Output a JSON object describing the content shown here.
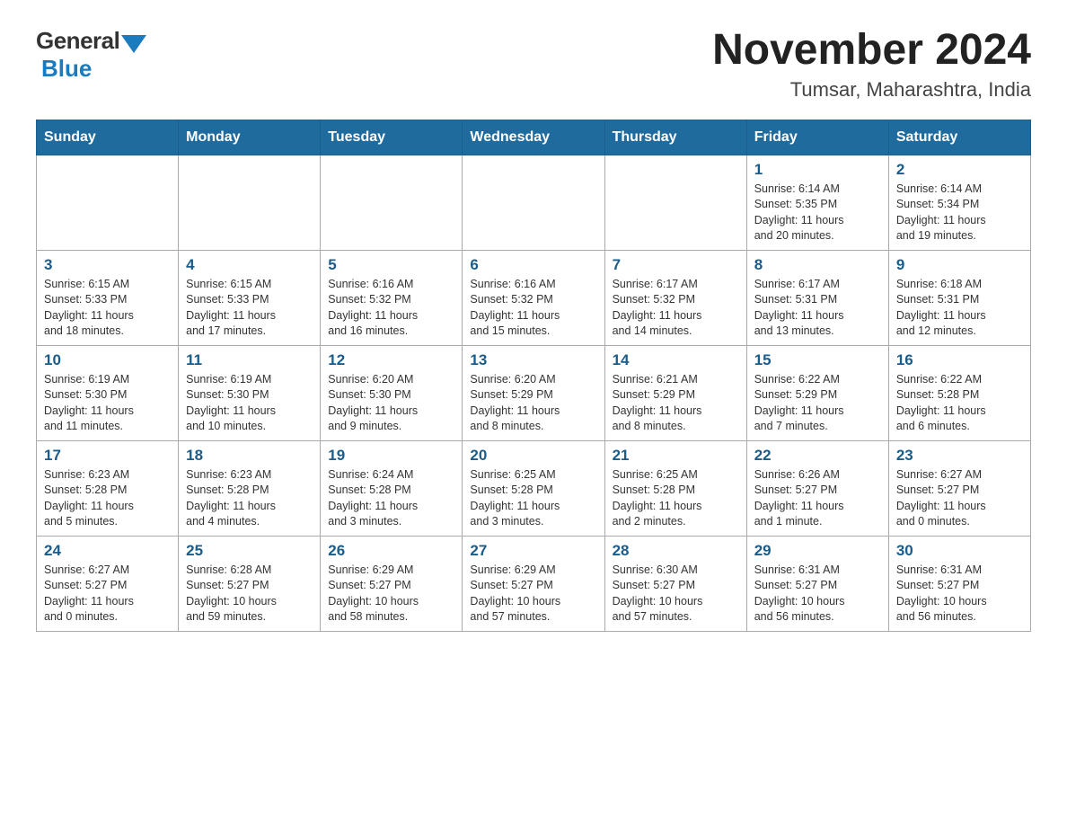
{
  "header": {
    "logo_general": "General",
    "logo_blue": "Blue",
    "month_year": "November 2024",
    "location": "Tumsar, Maharashtra, India"
  },
  "days_of_week": [
    "Sunday",
    "Monday",
    "Tuesday",
    "Wednesday",
    "Thursday",
    "Friday",
    "Saturday"
  ],
  "weeks": [
    [
      {
        "day": "",
        "info": ""
      },
      {
        "day": "",
        "info": ""
      },
      {
        "day": "",
        "info": ""
      },
      {
        "day": "",
        "info": ""
      },
      {
        "day": "",
        "info": ""
      },
      {
        "day": "1",
        "info": "Sunrise: 6:14 AM\nSunset: 5:35 PM\nDaylight: 11 hours\nand 20 minutes."
      },
      {
        "day": "2",
        "info": "Sunrise: 6:14 AM\nSunset: 5:34 PM\nDaylight: 11 hours\nand 19 minutes."
      }
    ],
    [
      {
        "day": "3",
        "info": "Sunrise: 6:15 AM\nSunset: 5:33 PM\nDaylight: 11 hours\nand 18 minutes."
      },
      {
        "day": "4",
        "info": "Sunrise: 6:15 AM\nSunset: 5:33 PM\nDaylight: 11 hours\nand 17 minutes."
      },
      {
        "day": "5",
        "info": "Sunrise: 6:16 AM\nSunset: 5:32 PM\nDaylight: 11 hours\nand 16 minutes."
      },
      {
        "day": "6",
        "info": "Sunrise: 6:16 AM\nSunset: 5:32 PM\nDaylight: 11 hours\nand 15 minutes."
      },
      {
        "day": "7",
        "info": "Sunrise: 6:17 AM\nSunset: 5:32 PM\nDaylight: 11 hours\nand 14 minutes."
      },
      {
        "day": "8",
        "info": "Sunrise: 6:17 AM\nSunset: 5:31 PM\nDaylight: 11 hours\nand 13 minutes."
      },
      {
        "day": "9",
        "info": "Sunrise: 6:18 AM\nSunset: 5:31 PM\nDaylight: 11 hours\nand 12 minutes."
      }
    ],
    [
      {
        "day": "10",
        "info": "Sunrise: 6:19 AM\nSunset: 5:30 PM\nDaylight: 11 hours\nand 11 minutes."
      },
      {
        "day": "11",
        "info": "Sunrise: 6:19 AM\nSunset: 5:30 PM\nDaylight: 11 hours\nand 10 minutes."
      },
      {
        "day": "12",
        "info": "Sunrise: 6:20 AM\nSunset: 5:30 PM\nDaylight: 11 hours\nand 9 minutes."
      },
      {
        "day": "13",
        "info": "Sunrise: 6:20 AM\nSunset: 5:29 PM\nDaylight: 11 hours\nand 8 minutes."
      },
      {
        "day": "14",
        "info": "Sunrise: 6:21 AM\nSunset: 5:29 PM\nDaylight: 11 hours\nand 8 minutes."
      },
      {
        "day": "15",
        "info": "Sunrise: 6:22 AM\nSunset: 5:29 PM\nDaylight: 11 hours\nand 7 minutes."
      },
      {
        "day": "16",
        "info": "Sunrise: 6:22 AM\nSunset: 5:28 PM\nDaylight: 11 hours\nand 6 minutes."
      }
    ],
    [
      {
        "day": "17",
        "info": "Sunrise: 6:23 AM\nSunset: 5:28 PM\nDaylight: 11 hours\nand 5 minutes."
      },
      {
        "day": "18",
        "info": "Sunrise: 6:23 AM\nSunset: 5:28 PM\nDaylight: 11 hours\nand 4 minutes."
      },
      {
        "day": "19",
        "info": "Sunrise: 6:24 AM\nSunset: 5:28 PM\nDaylight: 11 hours\nand 3 minutes."
      },
      {
        "day": "20",
        "info": "Sunrise: 6:25 AM\nSunset: 5:28 PM\nDaylight: 11 hours\nand 3 minutes."
      },
      {
        "day": "21",
        "info": "Sunrise: 6:25 AM\nSunset: 5:28 PM\nDaylight: 11 hours\nand 2 minutes."
      },
      {
        "day": "22",
        "info": "Sunrise: 6:26 AM\nSunset: 5:27 PM\nDaylight: 11 hours\nand 1 minute."
      },
      {
        "day": "23",
        "info": "Sunrise: 6:27 AM\nSunset: 5:27 PM\nDaylight: 11 hours\nand 0 minutes."
      }
    ],
    [
      {
        "day": "24",
        "info": "Sunrise: 6:27 AM\nSunset: 5:27 PM\nDaylight: 11 hours\nand 0 minutes."
      },
      {
        "day": "25",
        "info": "Sunrise: 6:28 AM\nSunset: 5:27 PM\nDaylight: 10 hours\nand 59 minutes."
      },
      {
        "day": "26",
        "info": "Sunrise: 6:29 AM\nSunset: 5:27 PM\nDaylight: 10 hours\nand 58 minutes."
      },
      {
        "day": "27",
        "info": "Sunrise: 6:29 AM\nSunset: 5:27 PM\nDaylight: 10 hours\nand 57 minutes."
      },
      {
        "day": "28",
        "info": "Sunrise: 6:30 AM\nSunset: 5:27 PM\nDaylight: 10 hours\nand 57 minutes."
      },
      {
        "day": "29",
        "info": "Sunrise: 6:31 AM\nSunset: 5:27 PM\nDaylight: 10 hours\nand 56 minutes."
      },
      {
        "day": "30",
        "info": "Sunrise: 6:31 AM\nSunset: 5:27 PM\nDaylight: 10 hours\nand 56 minutes."
      }
    ]
  ]
}
